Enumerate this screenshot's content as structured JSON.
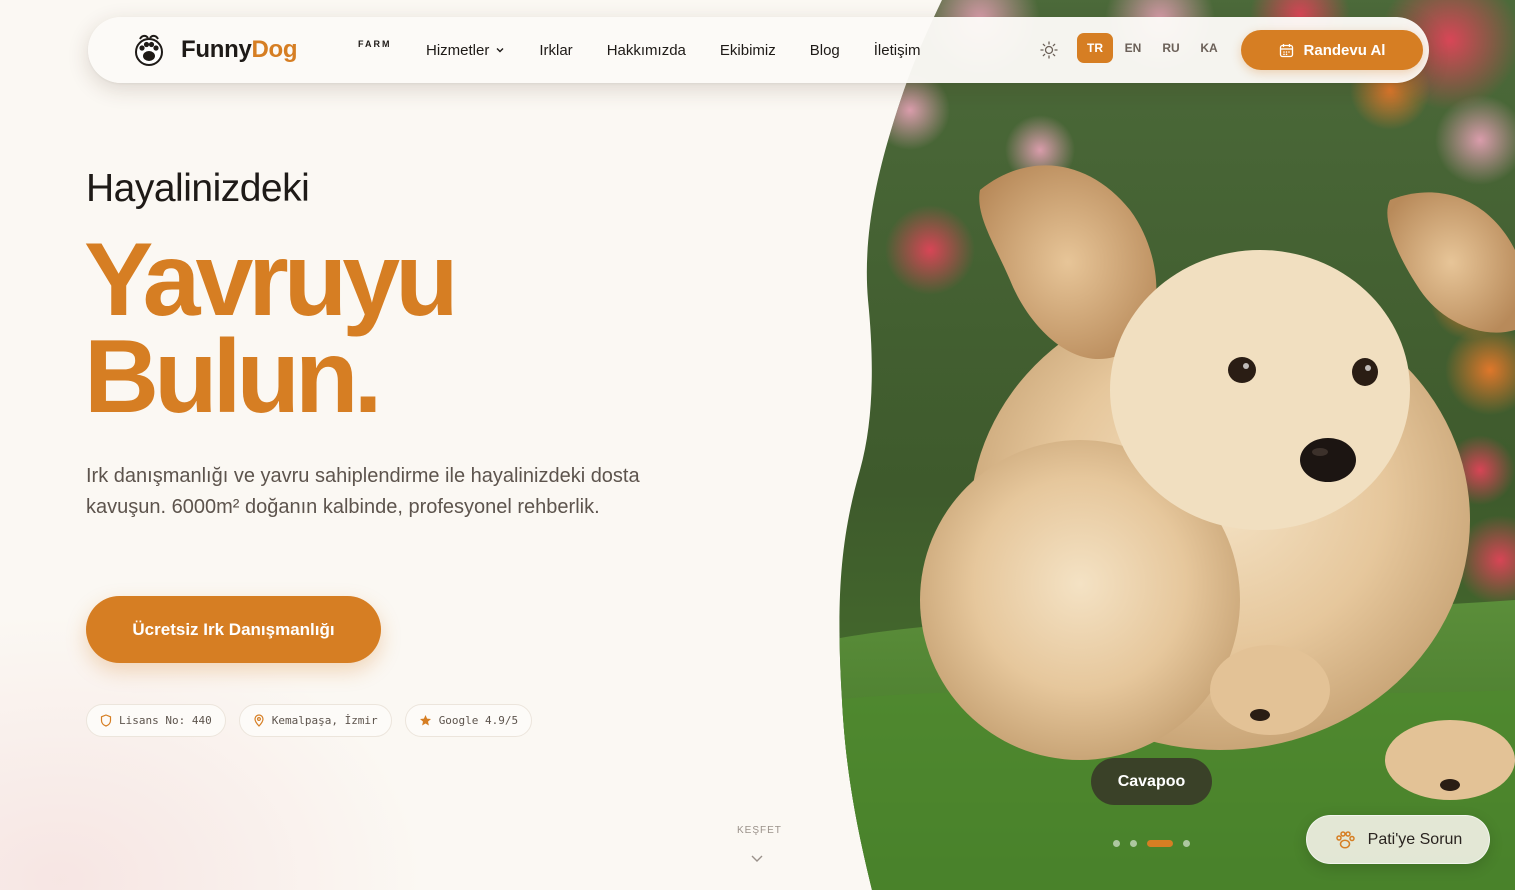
{
  "brand": {
    "name_part1": "Funny",
    "name_part2": "Dog",
    "suffix": "FARM",
    "accent_color": "#d67e23"
  },
  "nav": {
    "items": [
      {
        "label": "Hizmetler",
        "has_dropdown": true
      },
      {
        "label": "Irklar"
      },
      {
        "label": "Hakkımızda"
      },
      {
        "label": "Ekibimiz"
      },
      {
        "label": "Blog"
      },
      {
        "label": "İletişim"
      }
    ],
    "theme_icon": "sun-icon",
    "languages": [
      "TR",
      "EN",
      "RU",
      "KA"
    ],
    "active_language": "TR",
    "appointment_label": "Randevu Al"
  },
  "hero": {
    "kicker": "Hayalinizdeki",
    "title_line1": "Yavruyu",
    "title_line2": "Bulun.",
    "description": "Irk danışmanlığı ve yavru sahiplendirme ile hayalinizdeki dosta kavuşun. 6000m² doğanın kalbinde, profesyonel rehberlik.",
    "cta_label": "Ücretsiz Irk Danışmanlığı",
    "badges": [
      {
        "icon": "shield-icon",
        "text": "Lisans No: 440"
      },
      {
        "icon": "location-pin-icon",
        "text": "Kemalpaşa, İzmir"
      },
      {
        "icon": "star-icon",
        "text": "Google 4.9/5"
      }
    ],
    "explore_label": "KEŞFET"
  },
  "slider": {
    "breed_label": "Cavapoo",
    "slide_count": 4,
    "active_slide": 3
  },
  "chat": {
    "label": "Pati'ye Sorun",
    "icon": "paw-icon"
  }
}
